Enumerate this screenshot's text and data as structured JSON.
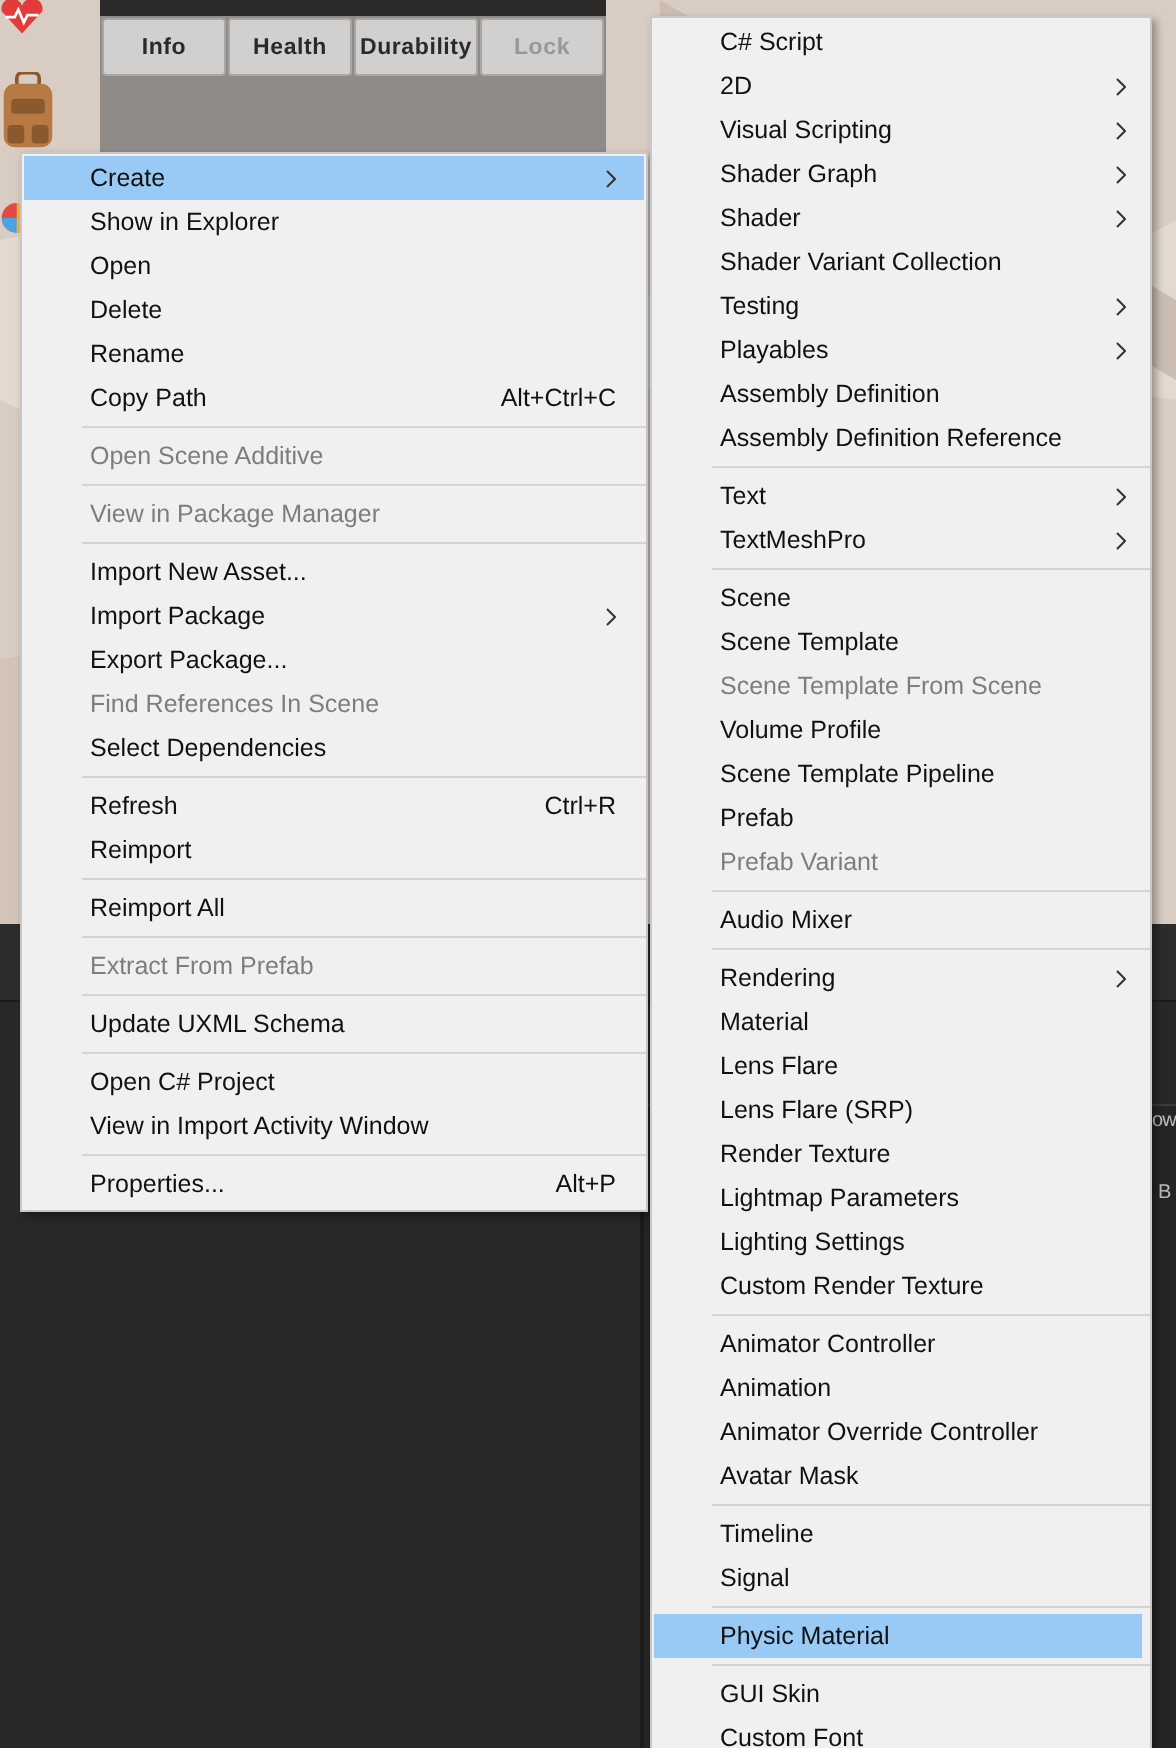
{
  "scene": {
    "tabs": [
      {
        "label": "Info",
        "disabled": false
      },
      {
        "label": "Health",
        "disabled": false
      },
      {
        "label": "Durability",
        "disabled": false
      },
      {
        "label": "Lock",
        "disabled": true
      }
    ]
  },
  "editor_texts": [
    "ow",
    "B"
  ],
  "context_menu": {
    "items": [
      {
        "kind": "item",
        "label": "Create",
        "submenu": true,
        "selected": true,
        "disabled": false
      },
      {
        "kind": "item",
        "label": "Show in Explorer",
        "selected": false,
        "disabled": false
      },
      {
        "kind": "item",
        "label": "Open",
        "selected": false,
        "disabled": false
      },
      {
        "kind": "item",
        "label": "Delete",
        "selected": false,
        "disabled": false
      },
      {
        "kind": "item",
        "label": "Rename",
        "selected": false,
        "disabled": false
      },
      {
        "kind": "item",
        "label": "Copy Path",
        "shortcut": "Alt+Ctrl+C",
        "selected": false,
        "disabled": false
      },
      {
        "kind": "separator"
      },
      {
        "kind": "item",
        "label": "Open Scene Additive",
        "selected": false,
        "disabled": true
      },
      {
        "kind": "separator"
      },
      {
        "kind": "item",
        "label": "View in Package Manager",
        "selected": false,
        "disabled": true
      },
      {
        "kind": "separator"
      },
      {
        "kind": "item",
        "label": "Import New Asset...",
        "selected": false,
        "disabled": false
      },
      {
        "kind": "item",
        "label": "Import Package",
        "submenu": true,
        "selected": false,
        "disabled": false
      },
      {
        "kind": "item",
        "label": "Export Package...",
        "selected": false,
        "disabled": false
      },
      {
        "kind": "item",
        "label": "Find References In Scene",
        "selected": false,
        "disabled": true
      },
      {
        "kind": "item",
        "label": "Select Dependencies",
        "selected": false,
        "disabled": false
      },
      {
        "kind": "separator"
      },
      {
        "kind": "item",
        "label": "Refresh",
        "shortcut": "Ctrl+R",
        "selected": false,
        "disabled": false
      },
      {
        "kind": "item",
        "label": "Reimport",
        "selected": false,
        "disabled": false
      },
      {
        "kind": "separator"
      },
      {
        "kind": "item",
        "label": "Reimport All",
        "selected": false,
        "disabled": false
      },
      {
        "kind": "separator"
      },
      {
        "kind": "item",
        "label": "Extract From Prefab",
        "selected": false,
        "disabled": true
      },
      {
        "kind": "separator"
      },
      {
        "kind": "item",
        "label": "Update UXML Schema",
        "selected": false,
        "disabled": false
      },
      {
        "kind": "separator"
      },
      {
        "kind": "item",
        "label": "Open C# Project",
        "selected": false,
        "disabled": false
      },
      {
        "kind": "item",
        "label": "View in Import Activity Window",
        "selected": false,
        "disabled": false
      },
      {
        "kind": "separator"
      },
      {
        "kind": "item",
        "label": "Properties...",
        "shortcut": "Alt+P",
        "selected": false,
        "disabled": false
      }
    ]
  },
  "submenu": {
    "items": [
      {
        "kind": "item",
        "label": "C# Script",
        "selected": false,
        "disabled": false
      },
      {
        "kind": "item",
        "label": "2D",
        "submenu": true,
        "selected": false,
        "disabled": false
      },
      {
        "kind": "item",
        "label": "Visual Scripting",
        "submenu": true,
        "selected": false,
        "disabled": false
      },
      {
        "kind": "item",
        "label": "Shader Graph",
        "submenu": true,
        "selected": false,
        "disabled": false
      },
      {
        "kind": "item",
        "label": "Shader",
        "submenu": true,
        "selected": false,
        "disabled": false
      },
      {
        "kind": "item",
        "label": "Shader Variant Collection",
        "selected": false,
        "disabled": false
      },
      {
        "kind": "item",
        "label": "Testing",
        "submenu": true,
        "selected": false,
        "disabled": false
      },
      {
        "kind": "item",
        "label": "Playables",
        "submenu": true,
        "selected": false,
        "disabled": false
      },
      {
        "kind": "item",
        "label": "Assembly Definition",
        "selected": false,
        "disabled": false
      },
      {
        "kind": "item",
        "label": "Assembly Definition Reference",
        "selected": false,
        "disabled": false
      },
      {
        "kind": "separator"
      },
      {
        "kind": "item",
        "label": "Text",
        "submenu": true,
        "selected": false,
        "disabled": false
      },
      {
        "kind": "item",
        "label": "TextMeshPro",
        "submenu": true,
        "selected": false,
        "disabled": false
      },
      {
        "kind": "separator"
      },
      {
        "kind": "item",
        "label": "Scene",
        "selected": false,
        "disabled": false
      },
      {
        "kind": "item",
        "label": "Scene Template",
        "selected": false,
        "disabled": false
      },
      {
        "kind": "item",
        "label": "Scene Template From Scene",
        "selected": false,
        "disabled": true
      },
      {
        "kind": "item",
        "label": "Volume Profile",
        "selected": false,
        "disabled": false
      },
      {
        "kind": "item",
        "label": "Scene Template Pipeline",
        "selected": false,
        "disabled": false
      },
      {
        "kind": "item",
        "label": "Prefab",
        "selected": false,
        "disabled": false
      },
      {
        "kind": "item",
        "label": "Prefab Variant",
        "selected": false,
        "disabled": true
      },
      {
        "kind": "separator"
      },
      {
        "kind": "item",
        "label": "Audio Mixer",
        "selected": false,
        "disabled": false
      },
      {
        "kind": "separator"
      },
      {
        "kind": "item",
        "label": "Rendering",
        "submenu": true,
        "selected": false,
        "disabled": false
      },
      {
        "kind": "item",
        "label": "Material",
        "selected": false,
        "disabled": false
      },
      {
        "kind": "item",
        "label": "Lens Flare",
        "selected": false,
        "disabled": false
      },
      {
        "kind": "item",
        "label": "Lens Flare (SRP)",
        "selected": false,
        "disabled": false
      },
      {
        "kind": "item",
        "label": "Render Texture",
        "selected": false,
        "disabled": false
      },
      {
        "kind": "item",
        "label": "Lightmap Parameters",
        "selected": false,
        "disabled": false
      },
      {
        "kind": "item",
        "label": "Lighting Settings",
        "selected": false,
        "disabled": false
      },
      {
        "kind": "item",
        "label": "Custom Render Texture",
        "selected": false,
        "disabled": false
      },
      {
        "kind": "separator"
      },
      {
        "kind": "item",
        "label": "Animator Controller",
        "selected": false,
        "disabled": false
      },
      {
        "kind": "item",
        "label": "Animation",
        "selected": false,
        "disabled": false
      },
      {
        "kind": "item",
        "label": "Animator Override Controller",
        "selected": false,
        "disabled": false
      },
      {
        "kind": "item",
        "label": "Avatar Mask",
        "selected": false,
        "disabled": false
      },
      {
        "kind": "separator"
      },
      {
        "kind": "item",
        "label": "Timeline",
        "selected": false,
        "disabled": false
      },
      {
        "kind": "item",
        "label": "Signal",
        "selected": false,
        "disabled": false
      },
      {
        "kind": "separator"
      },
      {
        "kind": "item",
        "label": "Physic Material",
        "selected": true,
        "disabled": false
      },
      {
        "kind": "separator"
      },
      {
        "kind": "item",
        "label": "GUI Skin",
        "selected": false,
        "disabled": false
      },
      {
        "kind": "item",
        "label": "Custom Font",
        "selected": false,
        "disabled": false
      }
    ]
  }
}
